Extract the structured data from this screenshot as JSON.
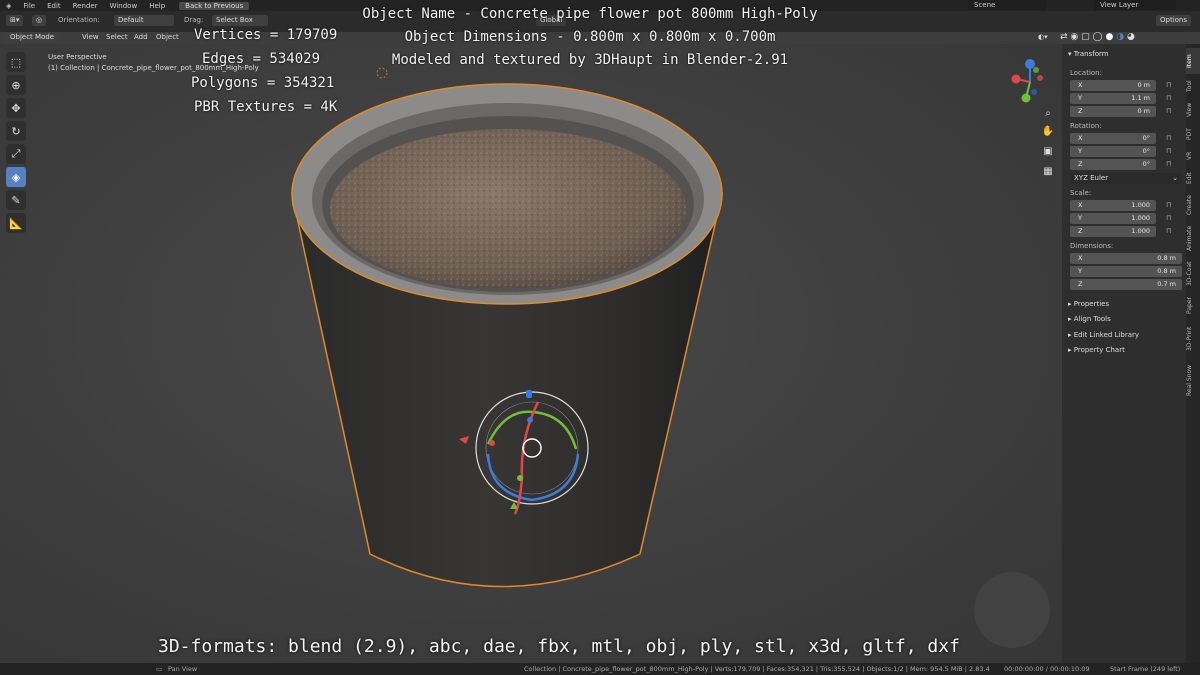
{
  "menu": {
    "items": [
      "File",
      "Edit",
      "Render",
      "Window",
      "Help"
    ],
    "back_button": "Back to Previous",
    "scene": "Scene",
    "view_layer": "View Layer"
  },
  "header": {
    "orientation_label": "Orientation:",
    "orientation_value": "Default",
    "drag_label": "Drag:",
    "drag_value": "Select Box",
    "transform_global": "Global",
    "options": "Options",
    "mode": "Object Mode",
    "view": "View",
    "select": "Select",
    "add": "Add",
    "object": "Object"
  },
  "viewport": {
    "perspective": "User Perspective",
    "collection": "(1) Collection | Concrete_pipe_flower_pot_800mm_High-Poly"
  },
  "overlay": {
    "vertices": "Vertices = 179709",
    "edges": "Edges = 534029",
    "polygons": "Polygons = 354321",
    "textures": "PBR Textures = 4K",
    "object_name": "Object Name - Concrete pipe flower pot 800mm High-Poly",
    "dimensions": "Object Dimensions -  0.800m x 0.800m x 0.700m",
    "credit": "Modeled and textured by 3DHaupt in Blender-2.91",
    "formats": "3D-formats: blend (2.9), abc, dae, fbx, mtl, obj, ply, stl, x3d, gltf, dxf"
  },
  "npanel": {
    "transform_header": "Transform",
    "location_label": "Location:",
    "location": [
      {
        "axis": "X",
        "value": "0 m"
      },
      {
        "axis": "Y",
        "value": "1.1 m"
      },
      {
        "axis": "Z",
        "value": "0 m"
      }
    ],
    "rotation_label": "Rotation:",
    "rotation": [
      {
        "axis": "X",
        "value": "0°"
      },
      {
        "axis": "Y",
        "value": "0°"
      },
      {
        "axis": "Z",
        "value": "0°"
      }
    ],
    "rotation_mode": "XYZ Euler",
    "scale_label": "Scale:",
    "scale": [
      {
        "axis": "X",
        "value": "1.000"
      },
      {
        "axis": "Y",
        "value": "1.000"
      },
      {
        "axis": "Z",
        "value": "1.000"
      }
    ],
    "dimensions_label": "Dimensions:",
    "dimensions": [
      {
        "axis": "X",
        "value": "0.8 m"
      },
      {
        "axis": "Y",
        "value": "0.8 m"
      },
      {
        "axis": "Z",
        "value": "0.7 m"
      }
    ],
    "subsections": [
      "Properties",
      "Align Tools",
      "Edit Linked Library",
      "Property Chart"
    ]
  },
  "tabs": [
    "Item",
    "Tool",
    "View",
    "PDT",
    "VR",
    "Edit",
    "Create",
    "Animate",
    "3D-Coat",
    "Paper",
    "3D-Print",
    "Real Snow"
  ],
  "status": {
    "left": "Pan View",
    "right": "Collection | Concrete_pipe_flower_pot_800mm_High-Poly | Verts:179,709 | Faces:354,321 | Tris:355,524 | Objects:1/2 | Mem: 954.5 MiB | 2.83.4",
    "time": "00:00:00:00 / 00:00:10:09",
    "frame": "Start Frame (249 left)"
  },
  "colors": {
    "accent": "#5680c2",
    "selection_outline": "#e08a2a",
    "background": "#3d3d3d"
  }
}
